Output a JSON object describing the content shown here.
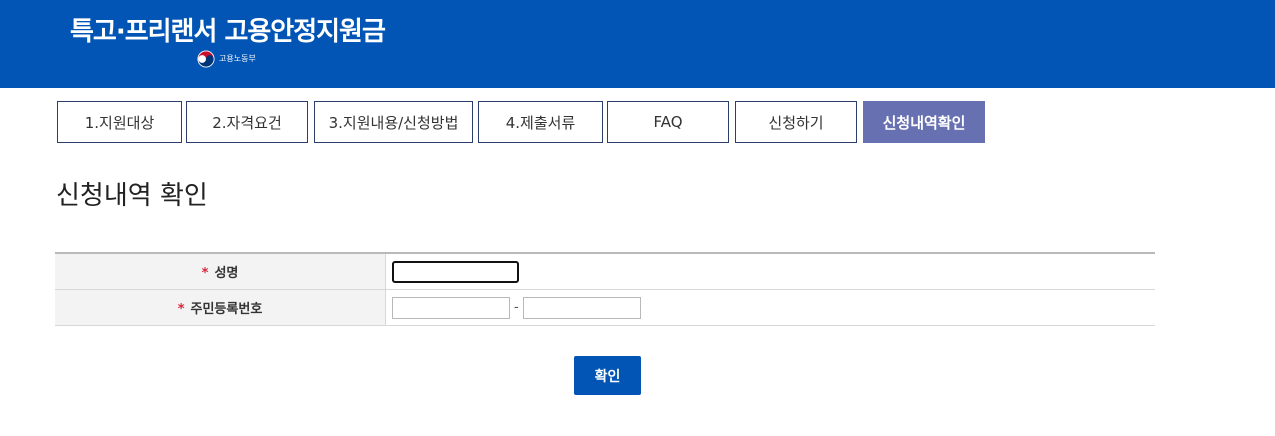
{
  "header": {
    "title": "특고·프리랜서 고용안정지원금",
    "ministry": "고용노동부",
    "background_color": "#0255b4"
  },
  "tabs": [
    {
      "label": "1.지원대상",
      "active": false
    },
    {
      "label": "2.자격요건",
      "active": false
    },
    {
      "label": "3.지원내용/신청방법",
      "active": false
    },
    {
      "label": "4.제출서류",
      "active": false
    },
    {
      "label": "FAQ",
      "active": false
    },
    {
      "label": "신청하기",
      "active": false
    },
    {
      "label": "신청내역확인",
      "active": true
    }
  ],
  "colors": {
    "active_tab": "#6770b0",
    "required_mark": "#d9263a"
  },
  "section": {
    "title": "신청내역 확인"
  },
  "form": {
    "required_mark": "*",
    "name_label": "성명",
    "name_value": "",
    "rrn_label": "주민등록번호",
    "rrn_front_value": "",
    "rrn_back_value": "",
    "rrn_separator": "-"
  },
  "actions": {
    "confirm_label": "확인"
  }
}
